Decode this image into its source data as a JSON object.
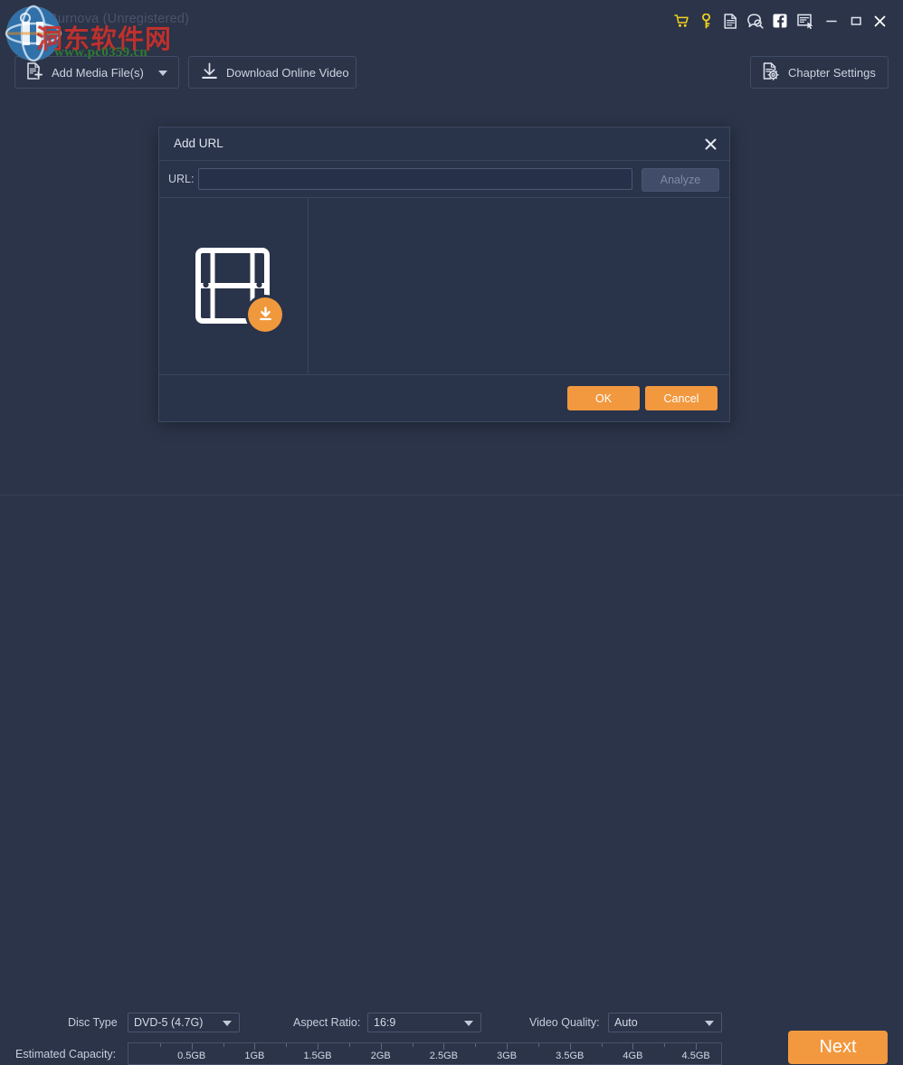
{
  "window": {
    "title": "Burnova (Unregistered)",
    "icons": [
      {
        "name": "cart-icon",
        "label": "Buy"
      },
      {
        "name": "key-icon",
        "label": "Register"
      },
      {
        "name": "document-icon",
        "label": "Help"
      },
      {
        "name": "support-chat-icon",
        "label": "Support"
      },
      {
        "name": "facebook-icon",
        "label": "Facebook"
      },
      {
        "name": "feedback-icon",
        "label": "Feedback"
      },
      {
        "name": "minimize-icon",
        "label": "Minimize"
      },
      {
        "name": "maximize-icon",
        "label": "Maximize"
      },
      {
        "name": "close-icon",
        "label": "Close"
      }
    ]
  },
  "watermark": {
    "chinese": "洞东软件网",
    "url": "www.pc0359.cn"
  },
  "toolbar": {
    "add_media_label": "Add Media File(s)",
    "download_online_label": "Download Online Video",
    "chapter_settings_label": "Chapter Settings"
  },
  "dialog": {
    "title": "Add URL",
    "url_label": "URL:",
    "url_value": "",
    "url_placeholder": "",
    "analyze_label": "Analyze",
    "analyze_enabled": false,
    "preview_icon": "film-strip-download-icon",
    "ok_label": "OK",
    "cancel_label": "Cancel",
    "close_icon": "close-icon"
  },
  "bottom": {
    "disc_type_label": "Disc Type",
    "disc_type_value": "DVD-5 (4.7G)",
    "aspect_ratio_label": "Aspect Ratio:",
    "aspect_ratio_value": "16:9",
    "video_quality_label": "Video Quality:",
    "video_quality_value": "Auto",
    "capacity_label": "Estimated Capacity:",
    "next_label": "Next",
    "ruler": {
      "max_gb": 4.7,
      "ticks": [
        {
          "value": 0.5,
          "label": "0.5GB"
        },
        {
          "value": 1.0,
          "label": "1GB"
        },
        {
          "value": 1.5,
          "label": "1.5GB"
        },
        {
          "value": 2.0,
          "label": "2GB"
        },
        {
          "value": 2.5,
          "label": "2.5GB"
        },
        {
          "value": 3.0,
          "label": "3GB"
        },
        {
          "value": 3.5,
          "label": "3.5GB"
        },
        {
          "value": 4.0,
          "label": "4GB"
        },
        {
          "value": 4.5,
          "label": "4.5GB"
        }
      ]
    }
  },
  "colors": {
    "app_bg": "#2b3449",
    "dialog_bg": "#29334a",
    "accent_orange": "#f2983e",
    "border": "#3d4963",
    "text": "#d4d9e4",
    "disabled_text": "#7f8ba4"
  }
}
